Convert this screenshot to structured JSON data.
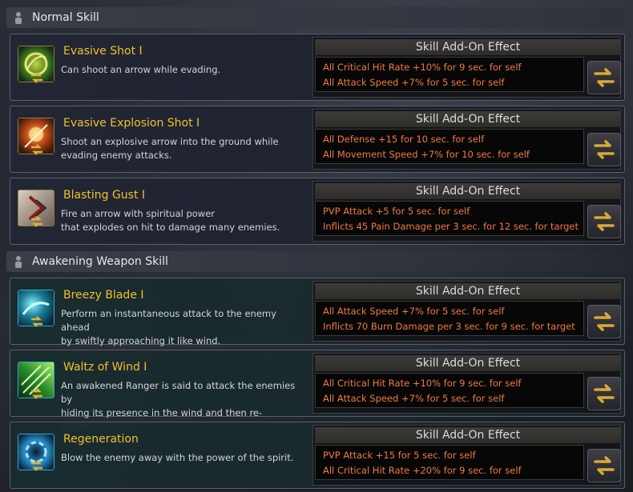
{
  "sections": [
    {
      "title": "Normal Skill",
      "icon": "person-icon"
    },
    {
      "title": "Awakening Weapon Skill",
      "icon": "person-icon"
    }
  ],
  "addon_title": "Skill Add-On Effect",
  "skills": [
    {
      "name": "Evasive Shot I",
      "desc": [
        "Can shoot an arrow while evading."
      ],
      "effects": [
        "All Critical Hit Rate +10% for 9 sec. for self",
        "All Attack Speed +7% for 5 sec. for self"
      ],
      "icon": "evasive-shot-skill-icon"
    },
    {
      "name": "Evasive Explosion Shot I",
      "desc": [
        "Shoot an explosive arrow into the ground while",
        "evading enemy attacks."
      ],
      "effects": [
        "All Defense +15 for 10 sec. for self",
        "All Movement Speed +7% for 10 sec. for self"
      ],
      "icon": "evasive-explosion-shot-skill-icon"
    },
    {
      "name": "Blasting Gust I",
      "desc": [
        "Fire an arrow with spiritual power",
        "that explodes on hit to damage many enemies."
      ],
      "effects": [
        "PVP Attack +5 for 5 sec. for self",
        "Inflicts 45 Pain Damage per 3 sec. for 12 sec. for target"
      ],
      "icon": "blasting-gust-skill-icon"
    },
    {
      "name": "Breezy Blade I",
      "desc": [
        "Perform an instantaneous attack to the enemy ahead",
        "by swiftly approaching it like wind."
      ],
      "effects": [
        "All Attack Speed +7% for 5 sec. for self",
        "Inflicts 70 Burn Damage per 3 sec. for 9 sec. for target"
      ],
      "icon": "breezy-blade-skill-icon"
    },
    {
      "name": "Waltz of Wind I",
      "desc": [
        "An awakened Ranger is said to attack the enemies by",
        "hiding its presence in the wind and then re-appearin..."
      ],
      "effects": [
        "All Critical Hit Rate +10% for 9 sec. for self",
        "All Attack Speed +7% for 5 sec. for self"
      ],
      "icon": "waltz-of-wind-skill-icon"
    },
    {
      "name": "Regeneration",
      "desc": [
        "Blow the enemy away with the power of the spirit."
      ],
      "effects": [
        "PVP Attack +15 for 5 sec. for self",
        "All Critical Hit Rate +20% for 9 sec. for self"
      ],
      "icon": "regeneration-skill-icon"
    }
  ]
}
